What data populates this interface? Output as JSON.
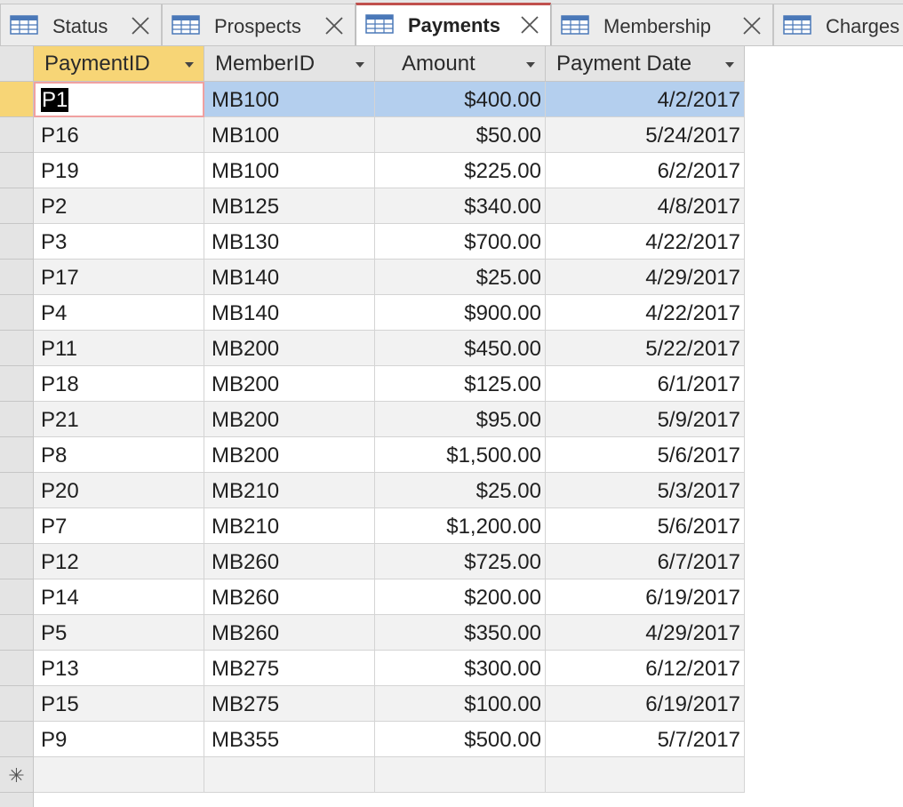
{
  "tabs": [
    {
      "label": "Status",
      "active": false
    },
    {
      "label": "Prospects",
      "active": false
    },
    {
      "label": "Payments",
      "active": true
    },
    {
      "label": "Membership",
      "active": false
    },
    {
      "label": "Charges",
      "active": false
    }
  ],
  "table": {
    "columns": [
      "PaymentID",
      "MemberID",
      "Amount",
      "Payment Date"
    ],
    "rows": [
      [
        "P1",
        "MB100",
        "$400.00",
        "4/2/2017"
      ],
      [
        "P16",
        "MB100",
        "$50.00",
        "5/24/2017"
      ],
      [
        "P19",
        "MB100",
        "$225.00",
        "6/2/2017"
      ],
      [
        "P2",
        "MB125",
        "$340.00",
        "4/8/2017"
      ],
      [
        "P3",
        "MB130",
        "$700.00",
        "4/22/2017"
      ],
      [
        "P17",
        "MB140",
        "$25.00",
        "4/29/2017"
      ],
      [
        "P4",
        "MB140",
        "$900.00",
        "4/22/2017"
      ],
      [
        "P11",
        "MB200",
        "$450.00",
        "5/22/2017"
      ],
      [
        "P18",
        "MB200",
        "$125.00",
        "6/1/2017"
      ],
      [
        "P21",
        "MB200",
        "$95.00",
        "5/9/2017"
      ],
      [
        "P8",
        "MB200",
        "$1,500.00",
        "5/6/2017"
      ],
      [
        "P20",
        "MB210",
        "$25.00",
        "5/3/2017"
      ],
      [
        "P7",
        "MB210",
        "$1,200.00",
        "5/6/2017"
      ],
      [
        "P12",
        "MB260",
        "$725.00",
        "6/7/2017"
      ],
      [
        "P14",
        "MB260",
        "$200.00",
        "6/19/2017"
      ],
      [
        "P5",
        "MB260",
        "$350.00",
        "4/29/2017"
      ],
      [
        "P13",
        "MB275",
        "$300.00",
        "6/12/2017"
      ],
      [
        "P15",
        "MB275",
        "$100.00",
        "6/19/2017"
      ],
      [
        "P9",
        "MB355",
        "$500.00",
        "5/7/2017"
      ]
    ],
    "new_record_marker": "✳"
  },
  "colors": {
    "active_tab_accent": "#c0504d",
    "selected_header": "#f7d576",
    "row_selection": "#b4cfee"
  }
}
